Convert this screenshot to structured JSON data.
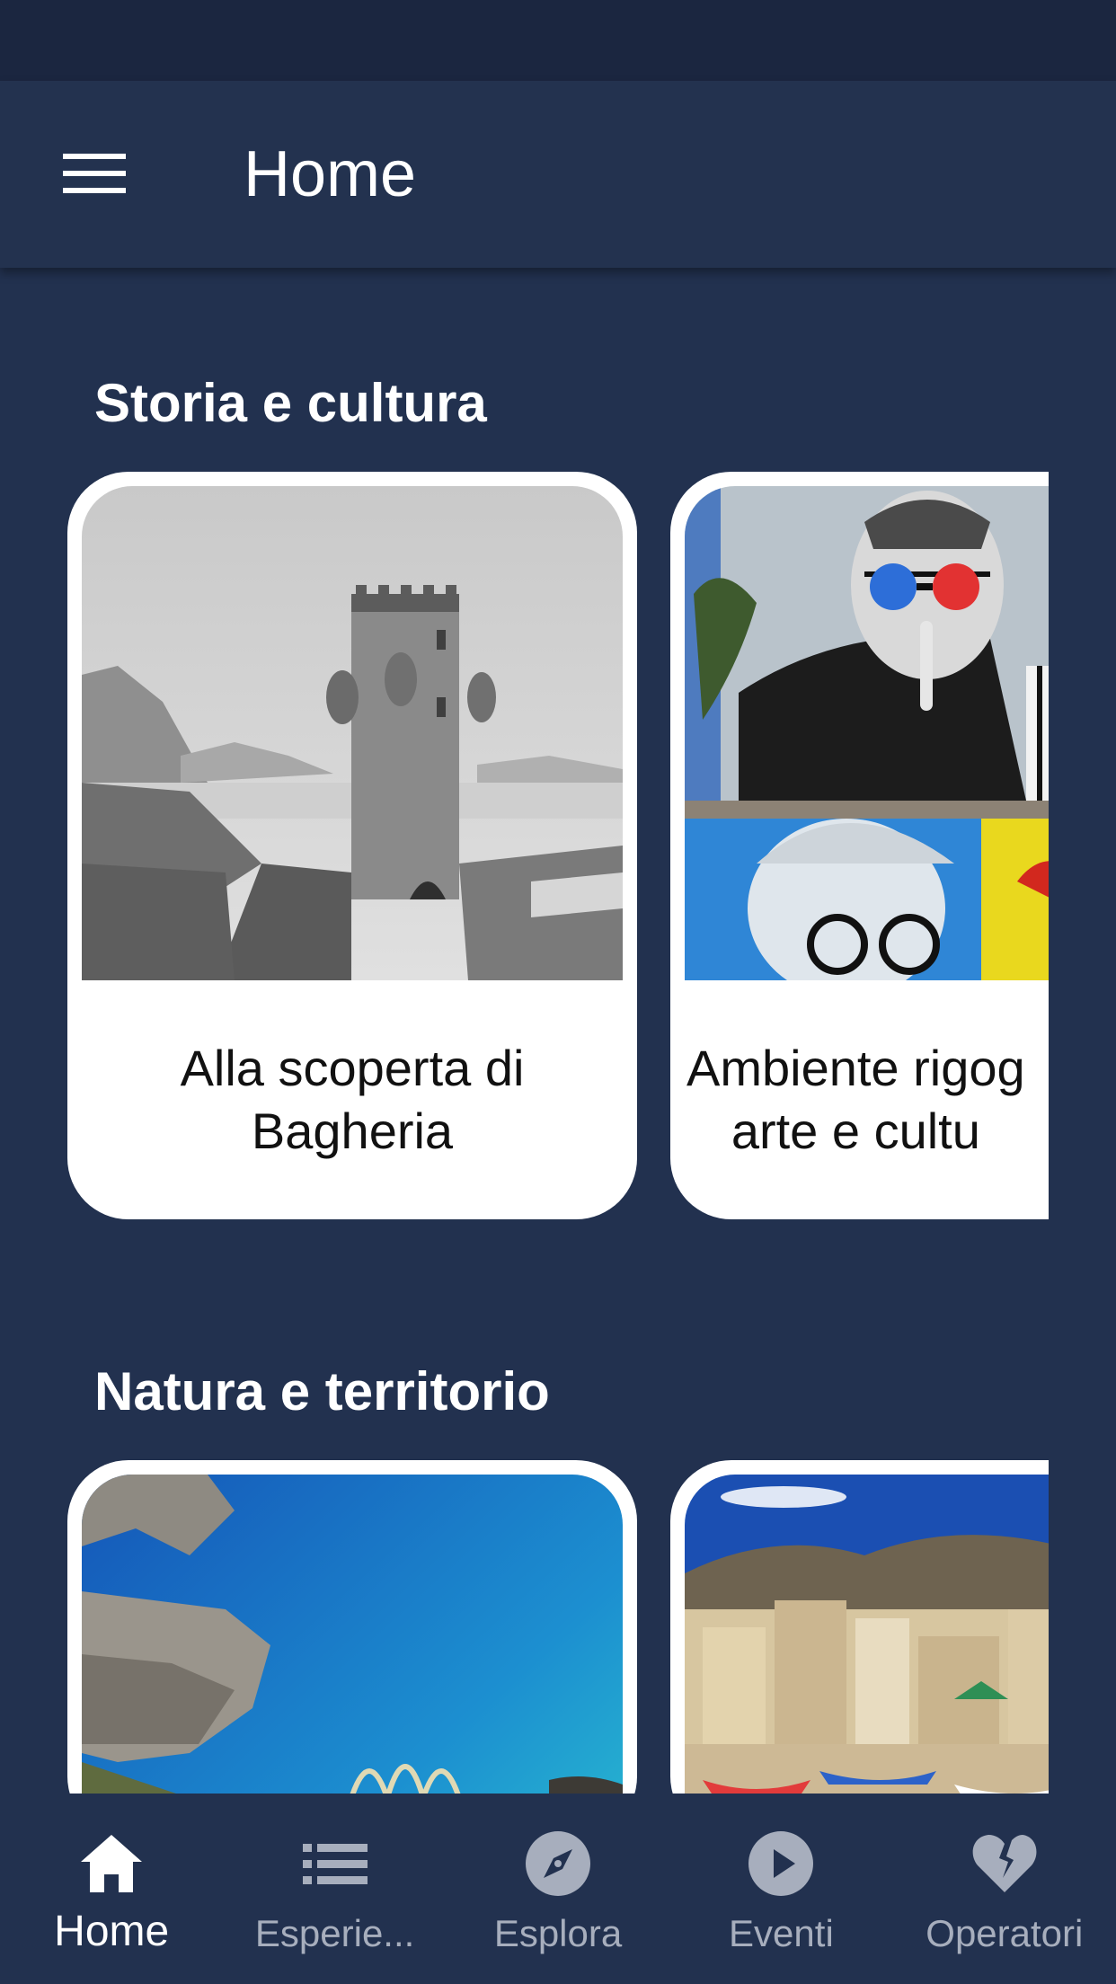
{
  "header": {
    "title": "Home",
    "menu_icon": "hamburger-menu-icon"
  },
  "sections": [
    {
      "title": "Storia e cultura",
      "cards": [
        {
          "caption": "Alla scoperta di Bagheria",
          "image": "engraving-castle-tower"
        },
        {
          "caption": "Ambiente rigog arte e cultu",
          "image": "street-art-murals"
        }
      ]
    },
    {
      "title": "Natura e territorio",
      "cards": [
        {
          "caption": "",
          "image": "turquoise-sea-cove"
        },
        {
          "caption": "",
          "image": "fishing-village-boats"
        }
      ]
    }
  ],
  "bottom_nav": {
    "active": "Home",
    "items": [
      {
        "label": "Home",
        "icon": "home-icon"
      },
      {
        "label": "Esperie...",
        "icon": "list-icon"
      },
      {
        "label": "Esplora",
        "icon": "compass-icon"
      },
      {
        "label": "Eventi",
        "icon": "play-circle-icon"
      },
      {
        "label": "Operatori",
        "icon": "broken-heart-icon"
      }
    ]
  },
  "colors": {
    "background": "#22314f",
    "status_bar": "#1b2640",
    "app_bar": "#23324f",
    "nav_inactive": "#a7aebd",
    "nav_active": "#ffffff"
  }
}
